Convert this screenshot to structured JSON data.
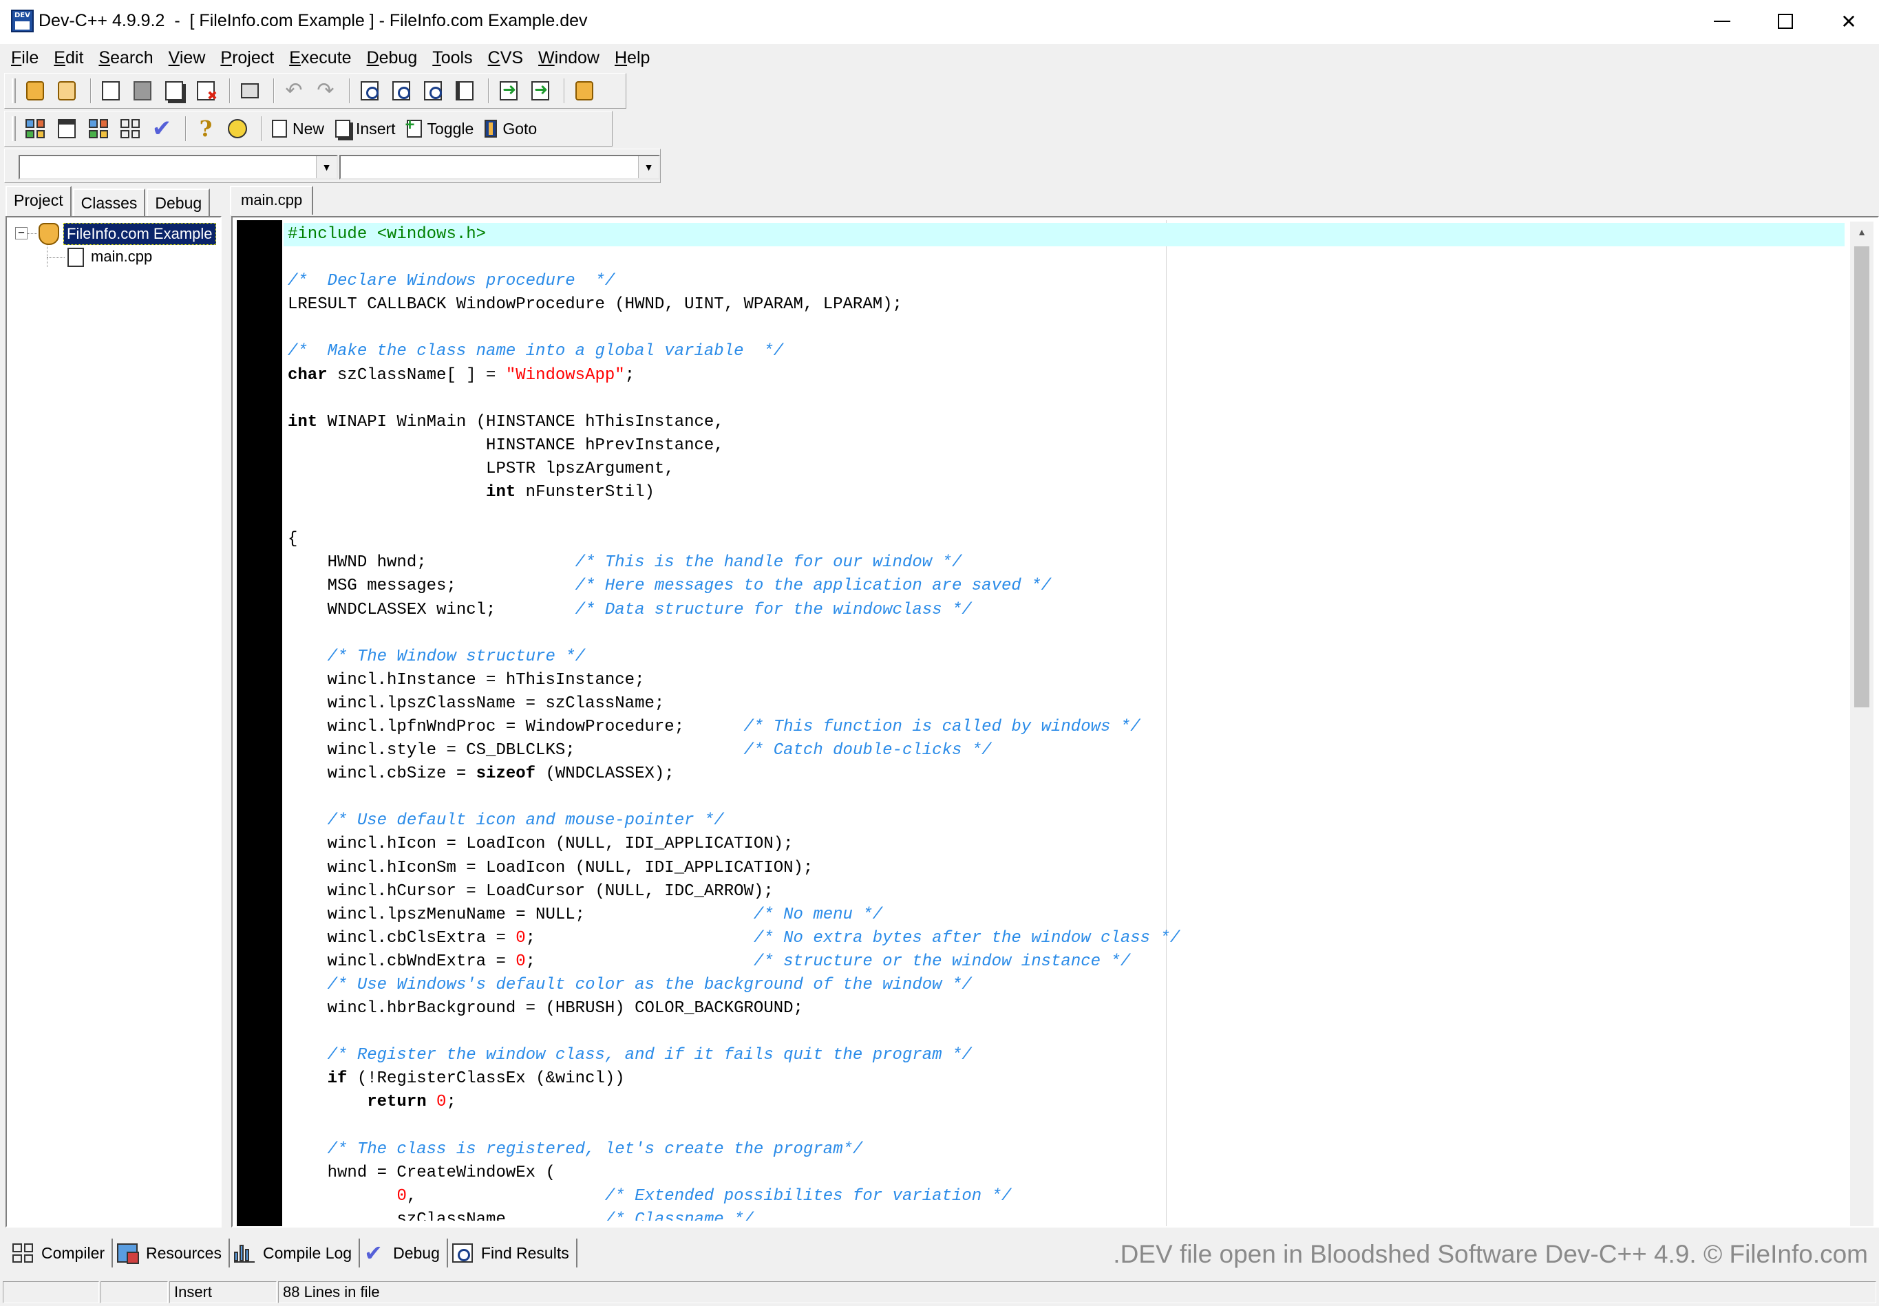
{
  "window": {
    "title": "Dev-C++ 4.9.9.2  -  [ FileInfo.com Example ] - FileInfo.com Example.dev",
    "icon_name": "devcpp-app-icon",
    "controls": [
      "minimize-icon",
      "maximize-icon",
      "close-icon"
    ]
  },
  "menu": [
    "File",
    "Edit",
    "Search",
    "View",
    "Project",
    "Execute",
    "Debug",
    "Tools",
    "CVS",
    "Window",
    "Help"
  ],
  "toolbar2": {
    "new_label": "New",
    "insert_label": "Insert",
    "toggle_label": "Toggle",
    "goto_label": "Goto"
  },
  "combos": {
    "class_value": "",
    "member_value": ""
  },
  "left_panel": {
    "tabs": [
      "Project",
      "Classes",
      "Debug"
    ],
    "active_tab": "Project",
    "tree": {
      "expander": "−",
      "project": "FileInfo.com Example",
      "files": [
        "main.cpp"
      ]
    }
  },
  "editor": {
    "tab": "main.cpp",
    "current_line": 1,
    "lines": [
      [
        [
          "prep",
          "#include <windows.h>"
        ]
      ],
      [],
      [
        [
          "com",
          "/*  Declare Windows procedure  */"
        ]
      ],
      [
        [
          "sym",
          "LRESULT CALLBACK WindowProcedure (HWND, UINT, WPARAM, LPARAM);"
        ]
      ],
      [],
      [
        [
          "com",
          "/*  Make the class name into a global variable  */"
        ]
      ],
      [
        [
          "kw",
          "char"
        ],
        [
          "sym",
          " szClassName[ ] = "
        ],
        [
          "str",
          "\"WindowsApp\""
        ],
        [
          "sym",
          ";"
        ]
      ],
      [],
      [
        [
          "kw",
          "int"
        ],
        [
          "sym",
          " WINAPI WinMain (HINSTANCE hThisInstance,"
        ]
      ],
      [
        [
          "sym",
          "                    HINSTANCE hPrevInstance,"
        ]
      ],
      [
        [
          "sym",
          "                    LPSTR lpszArgument,"
        ]
      ],
      [
        [
          "sym",
          "                    "
        ],
        [
          "kw",
          "int"
        ],
        [
          "sym",
          " nFunsterStil)"
        ]
      ],
      [],
      [
        [
          "sym",
          "{"
        ]
      ],
      [
        [
          "sym",
          "    HWND hwnd;               "
        ],
        [
          "com",
          "/* This is the handle for our window */"
        ]
      ],
      [
        [
          "sym",
          "    MSG messages;            "
        ],
        [
          "com",
          "/* Here messages to the application are saved */"
        ]
      ],
      [
        [
          "sym",
          "    WNDCLASSEX wincl;        "
        ],
        [
          "com",
          "/* Data structure for the windowclass */"
        ]
      ],
      [],
      [
        [
          "sym",
          "    "
        ],
        [
          "com",
          "/* The Window structure */"
        ]
      ],
      [
        [
          "sym",
          "    wincl.hInstance = hThisInstance;"
        ]
      ],
      [
        [
          "sym",
          "    wincl.lpszClassName = szClassName;"
        ]
      ],
      [
        [
          "sym",
          "    wincl.lpfnWndProc = WindowProcedure;      "
        ],
        [
          "com",
          "/* This function is called by windows */"
        ]
      ],
      [
        [
          "sym",
          "    wincl.style = CS_DBLCLKS;                 "
        ],
        [
          "com",
          "/* Catch double-clicks */"
        ]
      ],
      [
        [
          "sym",
          "    wincl.cbSize = "
        ],
        [
          "kw",
          "sizeof"
        ],
        [
          "sym",
          " (WNDCLASSEX);"
        ]
      ],
      [],
      [
        [
          "sym",
          "    "
        ],
        [
          "com",
          "/* Use default icon and mouse-pointer */"
        ]
      ],
      [
        [
          "sym",
          "    wincl.hIcon = LoadIcon (NULL, IDI_APPLICATION);"
        ]
      ],
      [
        [
          "sym",
          "    wincl.hIconSm = LoadIcon (NULL, IDI_APPLICATION);"
        ]
      ],
      [
        [
          "sym",
          "    wincl.hCursor = LoadCursor (NULL, IDC_ARROW);"
        ]
      ],
      [
        [
          "sym",
          "    wincl.lpszMenuName = NULL;                 "
        ],
        [
          "com",
          "/* No menu */"
        ]
      ],
      [
        [
          "sym",
          "    wincl.cbClsExtra = "
        ],
        [
          "num",
          "0"
        ],
        [
          "sym",
          ";                      "
        ],
        [
          "com",
          "/* No extra bytes after the window class */"
        ]
      ],
      [
        [
          "sym",
          "    wincl.cbWndExtra = "
        ],
        [
          "num",
          "0"
        ],
        [
          "sym",
          ";                      "
        ],
        [
          "com",
          "/* structure or the window instance */"
        ]
      ],
      [
        [
          "sym",
          "    "
        ],
        [
          "com",
          "/* Use Windows's default color as the background of the window */"
        ]
      ],
      [
        [
          "sym",
          "    wincl.hbrBackground = (HBRUSH) COLOR_BACKGROUND;"
        ]
      ],
      [],
      [
        [
          "sym",
          "    "
        ],
        [
          "com",
          "/* Register the window class, and if it fails quit the program */"
        ]
      ],
      [
        [
          "sym",
          "    "
        ],
        [
          "kw",
          "if"
        ],
        [
          "sym",
          " (!RegisterClassEx (&wincl))"
        ]
      ],
      [
        [
          "sym",
          "        "
        ],
        [
          "kw",
          "return"
        ],
        [
          "sym",
          " "
        ],
        [
          "num",
          "0"
        ],
        [
          "sym",
          ";"
        ]
      ],
      [],
      [
        [
          "sym",
          "    "
        ],
        [
          "com",
          "/* The class is registered, let's create the program*/"
        ]
      ],
      [
        [
          "sym",
          "    hwnd = CreateWindowEx ("
        ]
      ],
      [
        [
          "sym",
          "           "
        ],
        [
          "num",
          "0"
        ],
        [
          "sym",
          ",                   "
        ],
        [
          "com",
          "/* Extended possibilites for variation */"
        ]
      ],
      [
        [
          "sym",
          "           szClassName,         "
        ],
        [
          "com",
          "/* Classname */"
        ]
      ]
    ]
  },
  "bottom_tabs": [
    {
      "label": "Compiler",
      "icon": "compiler-grid-icon"
    },
    {
      "label": "Resources",
      "icon": "resources-icon"
    },
    {
      "label": "Compile Log",
      "icon": "compile-log-chart-icon"
    },
    {
      "label": "Debug",
      "icon": "debug-check-icon"
    },
    {
      "label": "Find Results",
      "icon": "find-results-icon"
    }
  ],
  "watermark": ".DEV file open in Bloodshed Software Dev-C++ 4.9. © FileInfo.com",
  "status": {
    "cell1": "",
    "cell2": "",
    "mode": "Insert",
    "lines": "88 Lines in file"
  },
  "colors": {
    "comment": "#2a8be8",
    "string": "#ff0000",
    "preprocessor": "#008000",
    "current_line_bg": "#d0ffff",
    "gutter": "#000000",
    "tree_selection": "#0a246a"
  }
}
